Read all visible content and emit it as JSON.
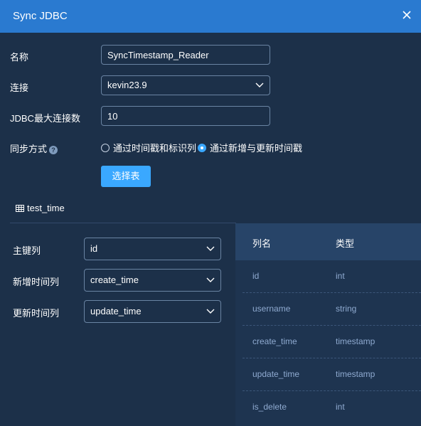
{
  "dialog": {
    "title": "Sync JDBC"
  },
  "form": {
    "name_label": "名称",
    "name_value": "SyncTimestamp_Reader",
    "connection_label": "连接",
    "connection_value": "kevin23.9",
    "max_conn_label": "JDBC最大连接数",
    "max_conn_value": "10",
    "sync_mode_label": "同步方式",
    "sync_modes": [
      {
        "label": "通过时间戳和标识列",
        "selected": false
      },
      {
        "label": "通过新增与更新时间戳",
        "selected": true
      }
    ],
    "select_table_button": "选择表"
  },
  "table": {
    "name": "test_time",
    "mapping": [
      {
        "label": "主键列",
        "value": "id"
      },
      {
        "label": "新增时间列",
        "value": "create_time"
      },
      {
        "label": "更新时间列",
        "value": "update_time"
      }
    ],
    "columns_header": {
      "name": "列名",
      "type": "类型"
    },
    "columns": [
      {
        "name": "id",
        "type": "int"
      },
      {
        "name": "username",
        "type": "string"
      },
      {
        "name": "create_time",
        "type": "timestamp"
      },
      {
        "name": "update_time",
        "type": "timestamp"
      },
      {
        "name": "is_delete",
        "type": "int"
      }
    ]
  },
  "colors": {
    "header_bg": "#2a7ad0",
    "body_bg": "#1c3049",
    "accent": "#3aa8ff",
    "column_text": "#8faad0"
  }
}
